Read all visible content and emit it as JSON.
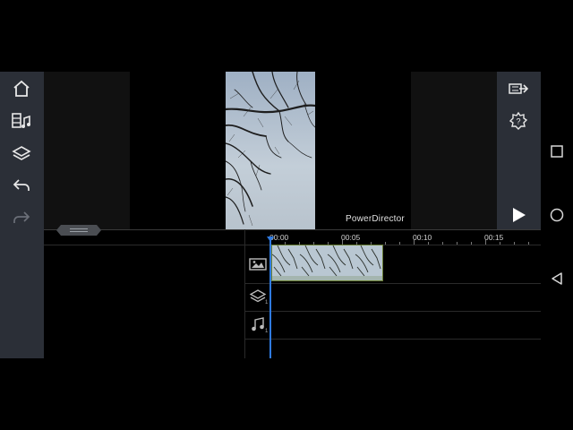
{
  "preview": {
    "watermark": "PowerDirector"
  },
  "timeline": {
    "ruler_labels": [
      "00:00",
      "00:05",
      "00:10",
      "00:15"
    ],
    "tracks": [
      {
        "name": "video",
        "icon": "image-track-icon"
      },
      {
        "name": "overlay",
        "icon": "layers-track-icon",
        "index": "1"
      },
      {
        "name": "audio",
        "icon": "music-track-icon",
        "index": "1"
      }
    ]
  },
  "colors": {
    "rail_bg": "#2b2f37",
    "playhead": "#2f7ae0",
    "clip_border": "#6a7f35"
  },
  "icons": {
    "left_rail": [
      "home-icon",
      "media-icon",
      "layers-icon",
      "undo-icon",
      "redo-icon"
    ],
    "right_rail": [
      "export-icon",
      "settings-icon",
      "play-icon"
    ],
    "android_nav": [
      "recents-icon",
      "home-circle-icon",
      "back-icon"
    ]
  }
}
